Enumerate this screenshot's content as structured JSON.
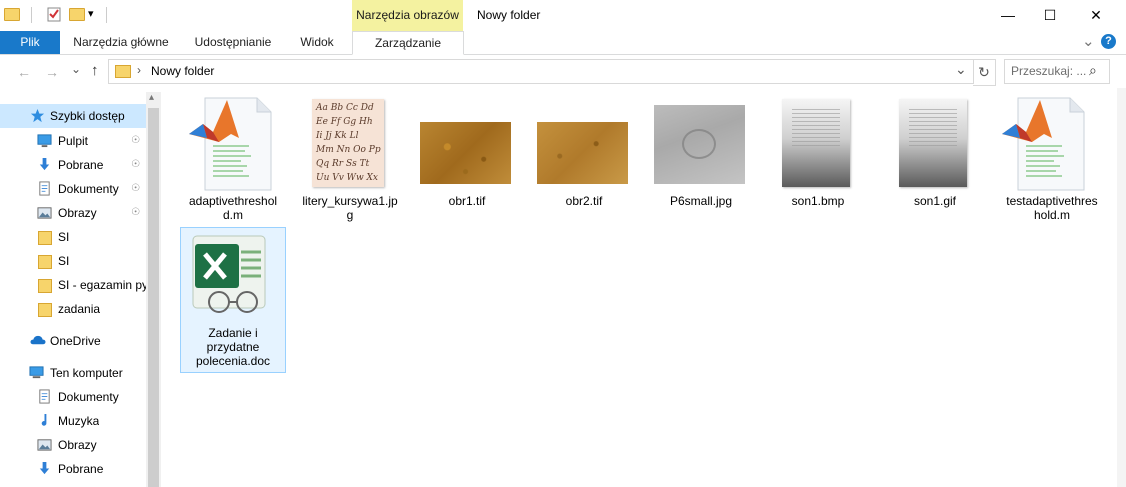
{
  "title": {
    "context_tab": "Narzędzia obrazów",
    "window_title": "Nowy folder",
    "minimize": "—",
    "maximize": "☐",
    "close": "✕",
    "qat_dropdown": "▾"
  },
  "ribbon": {
    "tabs": [
      "Plik",
      "Narzędzia główne",
      "Udostępnianie",
      "Widok",
      "Zarządzanie"
    ],
    "collapse_glyph": "⌄",
    "help_glyph": "?"
  },
  "address": {
    "back": "←",
    "forward": "→",
    "history": "⌄",
    "up": "↑",
    "separator": "›",
    "path": "Nowy folder",
    "dropdown": "⌄",
    "refresh": "↻",
    "search_placeholder": "Przeszukaj: ...",
    "search_icon": "⌕"
  },
  "sidebar": {
    "items": [
      {
        "label": "Szybki dostęp",
        "icon": "star-icon",
        "pinned": false
      },
      {
        "label": "Pulpit",
        "icon": "desktop-icon",
        "pinned": true
      },
      {
        "label": "Pobrane",
        "icon": "download-icon",
        "pinned": true
      },
      {
        "label": "Dokumenty",
        "icon": "documents-icon",
        "pinned": true
      },
      {
        "label": "Obrazy",
        "icon": "pictures-icon",
        "pinned": true
      },
      {
        "label": "SI",
        "icon": "folder-icon",
        "pinned": false
      },
      {
        "label": "SI",
        "icon": "folder-icon",
        "pinned": false
      },
      {
        "label": "SI - egazamin py",
        "icon": "folder-icon",
        "pinned": false
      },
      {
        "label": "zadania",
        "icon": "folder-icon",
        "pinned": false
      },
      {
        "label": "OneDrive",
        "icon": "onedrive-icon",
        "pinned": false
      },
      {
        "label": "Ten komputer",
        "icon": "computer-icon",
        "pinned": false
      },
      {
        "label": "Dokumenty",
        "icon": "documents-icon",
        "pinned": false
      },
      {
        "label": "Muzyka",
        "icon": "music-icon",
        "pinned": false
      },
      {
        "label": "Obrazy",
        "icon": "pictures-icon",
        "pinned": false
      },
      {
        "label": "Pobrane",
        "icon": "download-icon",
        "pinned": false
      }
    ],
    "pin_glyph": "📌",
    "scroll_up": "▴"
  },
  "files": [
    {
      "name": "adaptivethreshold.m",
      "line1": "adaptivethreshol",
      "line2": "d.m",
      "type": "matlab"
    },
    {
      "name": "litery_kursywa1.jpg",
      "line1": "litery_kursywa1.jp",
      "line2": "g",
      "type": "image-script"
    },
    {
      "name": "obr1.tif",
      "line1": "obr1.tif",
      "line2": "",
      "type": "image-brown"
    },
    {
      "name": "obr2.tif",
      "line1": "obr2.tif",
      "line2": "",
      "type": "image-brown"
    },
    {
      "name": "P6small.jpg",
      "line1": "P6small.jpg",
      "line2": "",
      "type": "image-gray"
    },
    {
      "name": "son1.bmp",
      "line1": "son1.bmp",
      "line2": "",
      "type": "image-doc"
    },
    {
      "name": "son1.gif",
      "line1": "son1.gif",
      "line2": "",
      "type": "image-doc"
    },
    {
      "name": "testadaptivethreshold.m",
      "line1": "testadaptivethres",
      "line2": "hold.m",
      "type": "matlab"
    },
    {
      "name": "Zadanie i przydatne polecenia.doc",
      "line1": "Zadanie i",
      "line2": "przydatne",
      "line3": "polecenia.doc",
      "type": "excel"
    }
  ],
  "script_rows": [
    "Aa Bb Cc Dd",
    "Ee Ff Gg Hh",
    "Ii Jj Kk Ll",
    "Mm Nn Oo Pp",
    "Qq Rr Ss Tt",
    "Uu Vv Ww Xx"
  ],
  "colors": {
    "file_tab": "#1979ca",
    "context_tab": "#f4f2a0",
    "selection": "#cce8ff",
    "folder": "#f7d46b"
  }
}
